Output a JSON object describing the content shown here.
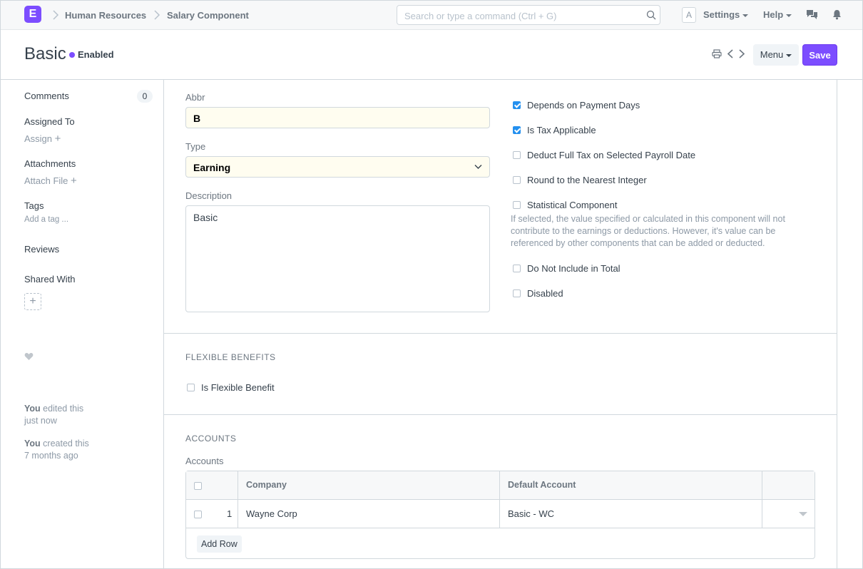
{
  "navbar": {
    "logo": "E",
    "breadcrumbs": [
      "Human Resources",
      "Salary Component"
    ],
    "search_placeholder": "Search or type a command (Ctrl + G)",
    "avatar": "A",
    "settings": "Settings",
    "help": "Help"
  },
  "page": {
    "title": "Basic",
    "status": "Enabled",
    "menu": "Menu",
    "save": "Save"
  },
  "sidebar": {
    "comments": "Comments",
    "comments_count": "0",
    "assigned_to": "Assigned To",
    "assign": "Assign",
    "attachments": "Attachments",
    "attach_file": "Attach File",
    "tags": "Tags",
    "add_tag": "Add a tag ...",
    "reviews": "Reviews",
    "shared_with": "Shared With",
    "activity": [
      {
        "who": "You",
        "action": "edited this",
        "when": "just now"
      },
      {
        "who": "You",
        "action": "created this",
        "when": "7 months ago"
      }
    ]
  },
  "form": {
    "abbr_label": "Abbr",
    "abbr_value": "B",
    "type_label": "Type",
    "type_value": "Earning",
    "description_label": "Description",
    "description_value": "Basic",
    "checkboxes": [
      {
        "label": "Depends on Payment Days",
        "checked": true
      },
      {
        "label": "Is Tax Applicable",
        "checked": true
      },
      {
        "label": "Deduct Full Tax on Selected Payroll Date",
        "checked": false
      },
      {
        "label": "Round to the Nearest Integer",
        "checked": false
      },
      {
        "label": "Statistical Component",
        "checked": false
      },
      {
        "label": "Do Not Include in Total",
        "checked": false
      },
      {
        "label": "Disabled",
        "checked": false
      }
    ],
    "statistical_help": "If selected, the value specified or calculated in this component will not contribute to the earnings or deductions. However, it's value can be referenced by other components that can be added or deducted."
  },
  "flexible": {
    "heading": "FLEXIBLE BENEFITS",
    "is_flexible_label": "Is Flexible Benefit",
    "is_flexible_checked": false
  },
  "accounts": {
    "heading": "ACCOUNTS",
    "table_label": "Accounts",
    "columns": [
      "Company",
      "Default Account"
    ],
    "rows": [
      {
        "idx": "1",
        "company": "Wayne Corp",
        "default_account": "Basic - WC"
      }
    ],
    "add_row": "Add Row"
  }
}
